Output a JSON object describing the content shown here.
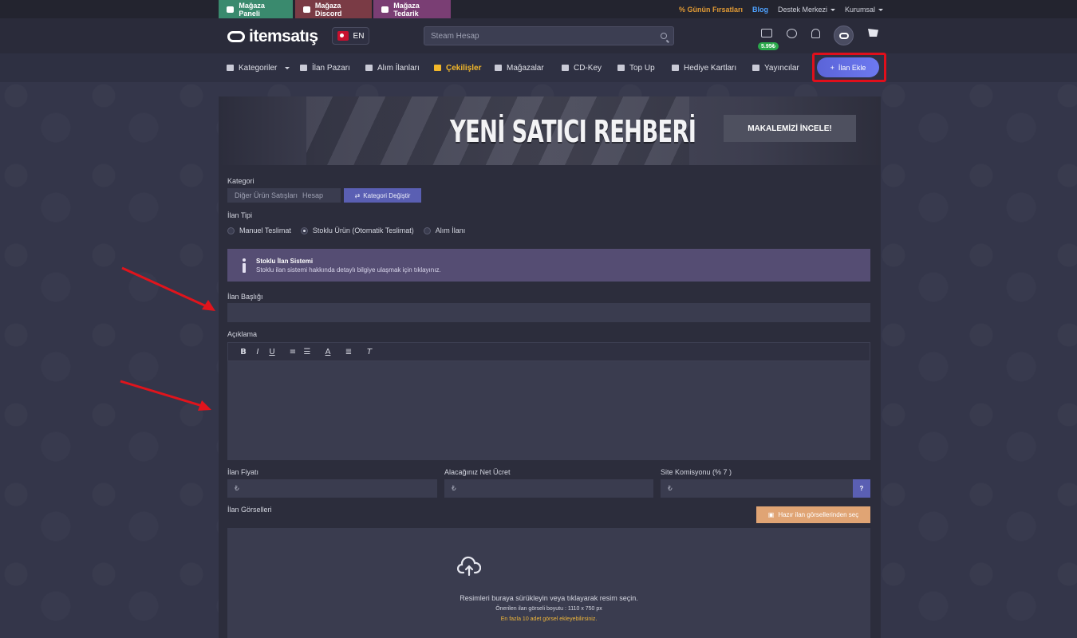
{
  "topbar": {
    "tabs": [
      {
        "label": "Mağaza Paneli",
        "icon": "store-icon"
      },
      {
        "label": "Mağaza Discord",
        "icon": "discord-icon"
      },
      {
        "label": "Mağaza Tedarik",
        "icon": "truck-icon"
      }
    ],
    "deals": "Günün Fırsatları",
    "blog": "Blog",
    "support": "Destek Merkezi",
    "corporate": "Kurumsal"
  },
  "header": {
    "logo": "itemsatış",
    "lang": "EN",
    "search_placeholder": "Steam Hesap",
    "balance": "5.95₺"
  },
  "nav": {
    "items": [
      {
        "label": "Kategoriler",
        "icon": "grid-icon"
      },
      {
        "label": "İlan Pazarı",
        "icon": "basket-icon"
      },
      {
        "label": "Alım İlanları",
        "icon": "bag-icon"
      },
      {
        "label": "Çekilişler",
        "icon": "gift-icon"
      },
      {
        "label": "Mağazalar",
        "icon": "store-icon"
      },
      {
        "label": "CD-Key",
        "icon": "key-icon"
      },
      {
        "label": "Top Up",
        "icon": "cart-icon"
      },
      {
        "label": "Hediye Kartları",
        "icon": "gift-card-icon"
      },
      {
        "label": "Yayıncılar",
        "icon": "gamepad-icon"
      }
    ],
    "add_listing": "İlan Ekle"
  },
  "banner": {
    "title": "YENİ SATICI REHBERİ",
    "button": "MAKALEMİZİ İNCELE!"
  },
  "form": {
    "category_label": "Kategori",
    "category_path": [
      "Diğer Ürün Satışları",
      "Hesap"
    ],
    "change_category": "Kategori Değiştir",
    "type_label": "İlan Tipi",
    "types": [
      "Manuel Teslimat",
      "Stoklu Ürün (Otomatik Teslimat)",
      "Alım İlanı"
    ],
    "selected_type": "Stoklu Ürün (Otomatik Teslimat)",
    "info_title": "Stoklu İlan Sistemi",
    "info_text": "Stoklu ilan sistemi hakkında detaylı bilgiye ulaşmak için tıklayınız.",
    "title_label": "İlan Başlığı",
    "title_value": "",
    "desc_label": "Açıklama",
    "price_label": "İlan Fiyatı",
    "net_label": "Alacağınız Net Ücret",
    "commission_label": "Site Komisyonu (% 7 )",
    "currency": "₺",
    "commission_help": "?",
    "images_label": "İlan Görselleri",
    "ready_images": "Hazır ilan görsellerinden seç",
    "drop_main": "Resimleri buraya sürükleyin veya tıklayarak resim seçin.",
    "drop_size": "Önerilen ilan görseli boyutu : 1110 x 750 px",
    "drop_limit": "En fazla 10 adet görsel ekleyebilirsiniz."
  },
  "colors": {
    "accent": "#5b64d8",
    "highlight_box": "#e00f1b",
    "arrow": "#e0141c",
    "active_nav": "#f2b72a",
    "balance": "#2aa84a"
  }
}
